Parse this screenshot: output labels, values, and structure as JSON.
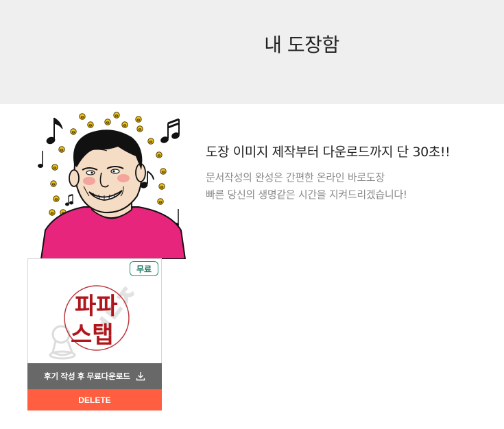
{
  "header": {
    "title": "내 도장함",
    "background": "#efefef"
  },
  "promo": {
    "headline": "도장 이미지 제작부터 다운로드까지 단 30초!!",
    "description_line1": "문서작성의 완성은 간편한 온라인 바로도장",
    "description_line2": "빠른 당신의 생명같은 시간을 지켜드리겠습니다!"
  },
  "stamp_card": {
    "badge": "무료",
    "stamp_text_line1": "파파",
    "stamp_text_line2": "스탭",
    "download_label": "후기 작성 후 무료다운로드",
    "delete_label": "DELETE",
    "stamp_color": "#b0161c",
    "badge_color": "#1f8a6e",
    "download_bar_color": "#686868",
    "delete_bar_color": "#ff5f40"
  },
  "icons": {
    "download": "download-icon",
    "music_note": "music-note-icon",
    "pig_coin": "pig-face-icon"
  }
}
